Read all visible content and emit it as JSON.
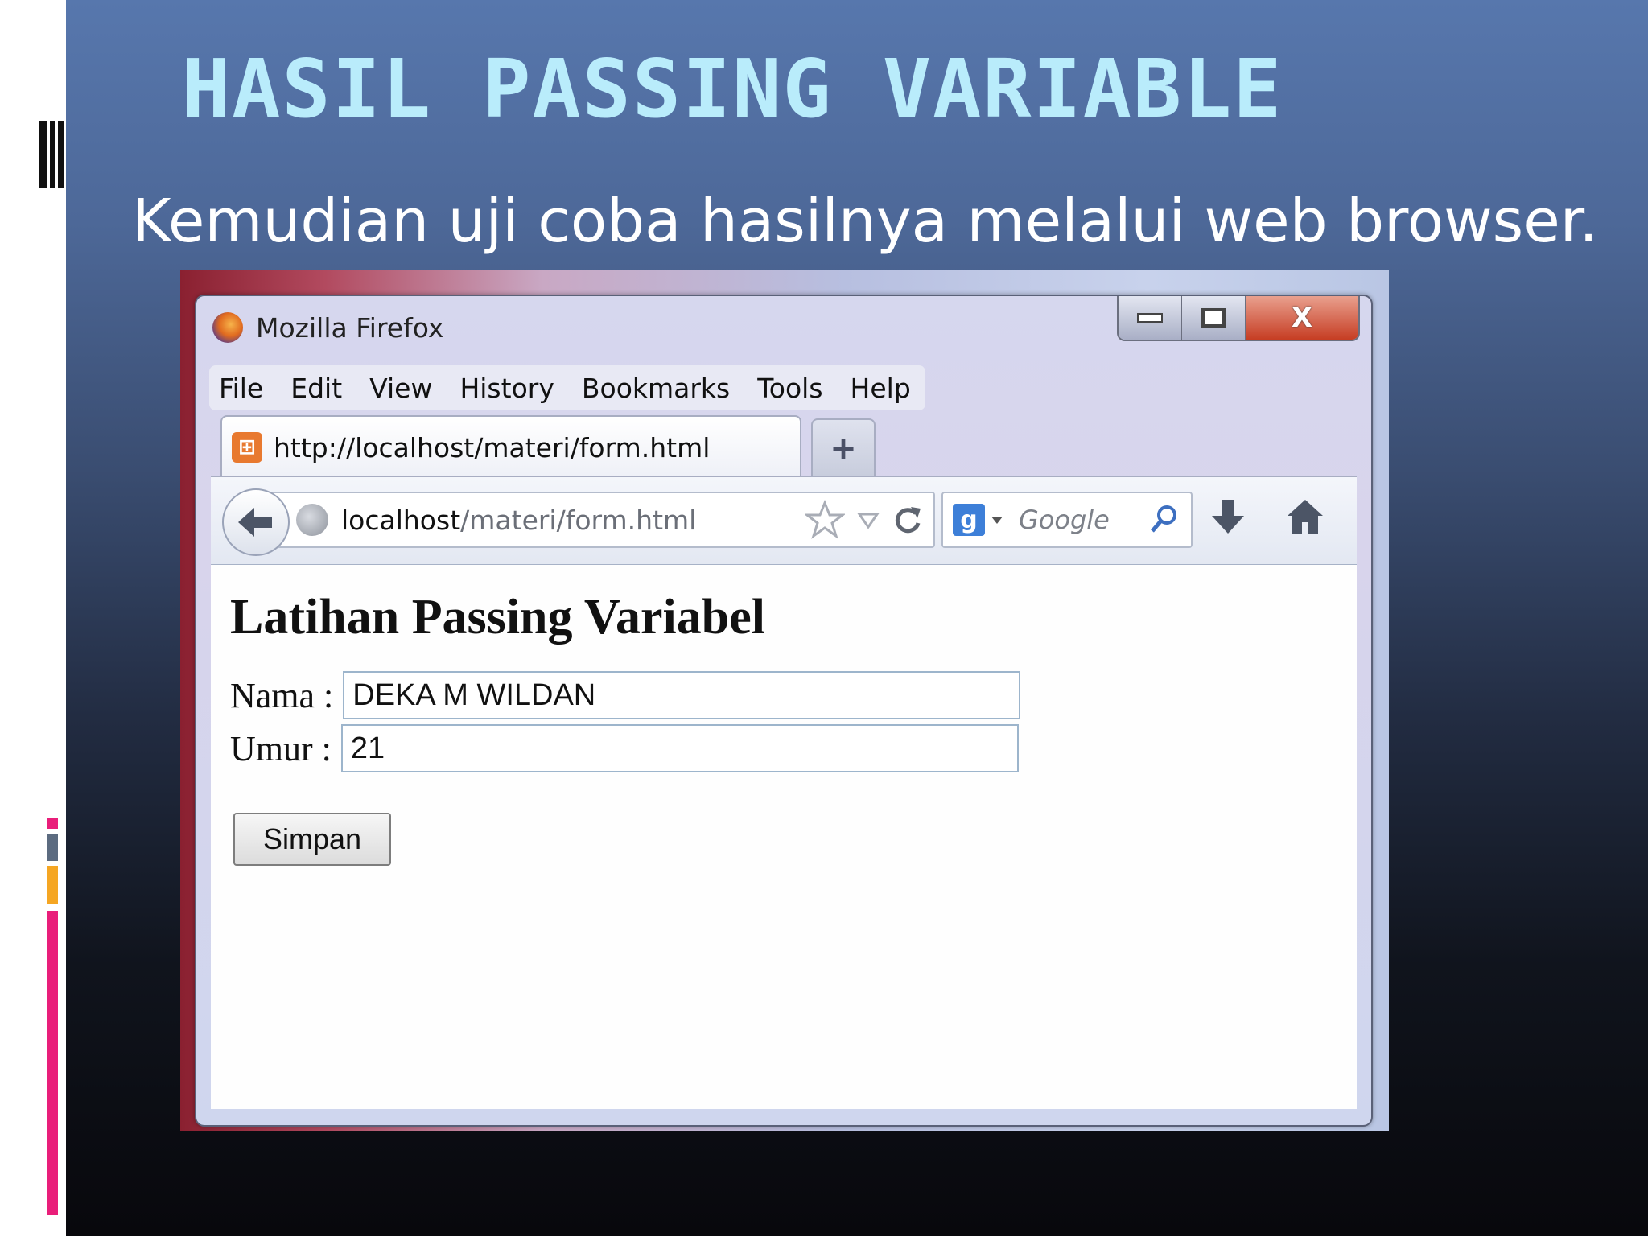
{
  "slide": {
    "title": "HASIL PASSING VARIABLE",
    "subtitle": "Kemudian uji coba hasilnya melalui web browser.",
    "accent_colors": [
      "#1a1a1a",
      "#e91e7a",
      "#f5a623",
      "#5c6b80"
    ]
  },
  "browser": {
    "window_title": "Mozilla Firefox",
    "window_controls": {
      "minimize": "minimize-icon",
      "maximize": "maximize-icon",
      "close": "X"
    },
    "menu": [
      "File",
      "Edit",
      "View",
      "History",
      "Bookmarks",
      "Tools",
      "Help"
    ],
    "tab": {
      "label": "http://localhost/materi/form.html",
      "favicon": "xampp-icon"
    },
    "new_tab_label": "+",
    "address": {
      "host": "localhost",
      "path": "/materi/form.html"
    },
    "search": {
      "engine_icon": "g",
      "placeholder": "Google"
    }
  },
  "page": {
    "heading": "Latihan Passing Variabel",
    "form": {
      "nama_label": "Nama :",
      "nama_value": "DEKA M WILDAN",
      "umur_label": "Umur :",
      "umur_value": "21",
      "submit_label": "Simpan"
    }
  }
}
